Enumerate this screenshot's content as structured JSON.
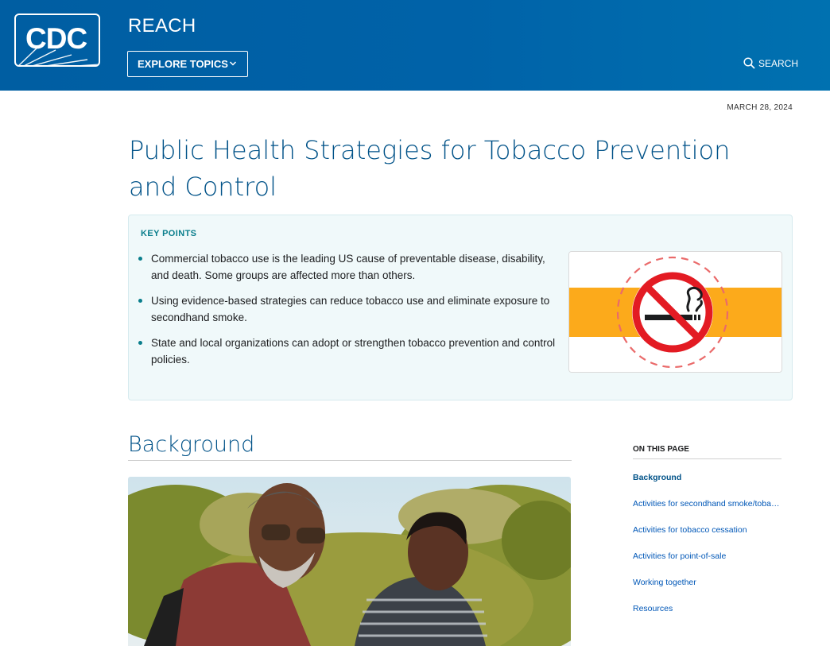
{
  "header": {
    "logo_text": "CDC",
    "site_title": "REACH",
    "explore_label": "EXPLORE TOPICS",
    "search_label": "SEARCH",
    "bg_color": "#005ea2"
  },
  "date": "MARCH 28, 2024",
  "page_title": "Public Health Strategies for Tobacco Prevention and Control",
  "key_points": {
    "label": "KEY POINTS",
    "items": [
      "Commercial tobacco use is the leading US cause of preventable disease, disability, and death. Some groups are affected more than others.",
      "Using evidence-based strategies can reduce tobacco use and eliminate exposure to secondhand smoke.",
      "State and local organizations can adopt or strengthen tobacco prevention and control policies."
    ],
    "image_icon": "no-smoking-icon"
  },
  "section": {
    "title": "Background",
    "photo": "two-people-hiking-photo"
  },
  "on_this_page": {
    "heading": "ON THIS PAGE",
    "items": [
      "Background",
      "Activities for secondhand smoke/tobacco-free environments",
      "Activities for tobacco cessation",
      "Activities for point-of-sale",
      "Working together",
      "Resources"
    ]
  }
}
